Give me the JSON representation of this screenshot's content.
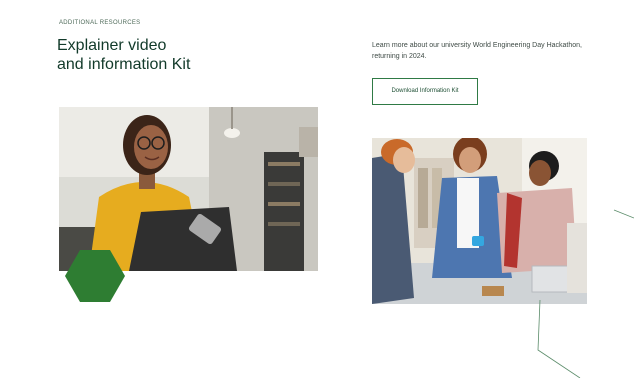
{
  "section": {
    "eyebrow": "ADDITIONAL RESOURCES",
    "title_line1": "Explainer video",
    "title_line2": "and information Kit",
    "intro": "Learn more about our university World Engineering Day Hackathon, returning in 2024.",
    "download_label": "Download Information Kit"
  },
  "colors": {
    "heading": "#123a2a",
    "accent": "#2f7a45",
    "hexagon": "#2e7d32"
  }
}
